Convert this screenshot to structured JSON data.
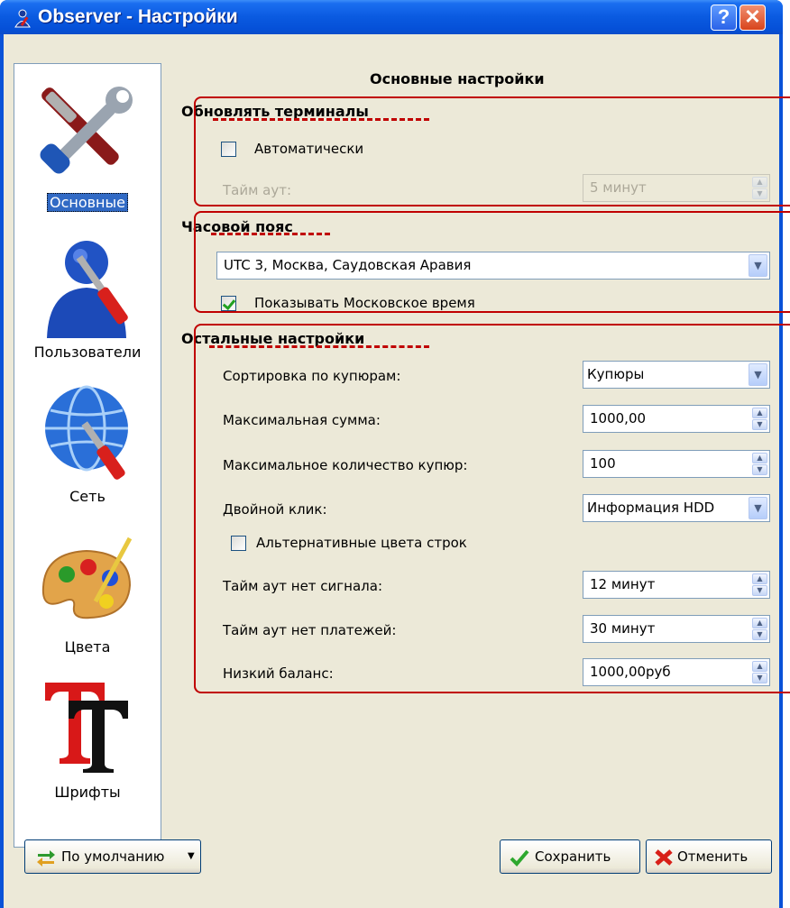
{
  "window": {
    "title": "Observer - Настройки",
    "help_glyph": "?",
    "close_glyph": "✕"
  },
  "sidebar": {
    "items": [
      {
        "label": "Основные",
        "icon": "tools-icon",
        "selected": true
      },
      {
        "label": "Пользователи",
        "icon": "users-icon"
      },
      {
        "label": "Сеть",
        "icon": "network-icon"
      },
      {
        "label": "Цвета",
        "icon": "palette-icon"
      },
      {
        "label": "Шрифты",
        "icon": "fonts-icon"
      }
    ]
  },
  "main": {
    "title": "Основные настройки",
    "update_terminals": {
      "heading": "Обновлять терминалы",
      "auto_label": "Автоматически",
      "auto_checked": false,
      "timeout_label": "Тайм аут:",
      "timeout_value": "5 минут"
    },
    "timezone": {
      "heading": "Часовой пояс",
      "selected": "UTC 3, Москва, Саудовская Аравия",
      "show_moscow_label": "Показывать Московское время",
      "show_moscow_checked": true
    },
    "other": {
      "heading": "Остальные настройки",
      "sort_label": "Сортировка по купюрам:",
      "sort_value": "Купюры",
      "max_sum_label": "Максимальная сумма:",
      "max_sum_value": "1000,00",
      "max_notes_label": "Максимальное количество купюр:",
      "max_notes_value": "100",
      "dblclick_label": "Двойной клик:",
      "dblclick_value": "Информация HDD",
      "alt_colors_label": "Альтернативные цвета строк",
      "alt_colors_checked": false,
      "no_signal_label": "Тайм аут нет сигнала:",
      "no_signal_value": "12 минут",
      "no_payments_label": "Тайм аут нет платежей:",
      "no_payments_value": "30 минут",
      "low_balance_label": "Низкий баланс:",
      "low_balance_value": "1000,00руб"
    }
  },
  "footer": {
    "defaults_label": "По умолчанию",
    "save_label": "Сохранить",
    "cancel_label": "Отменить"
  },
  "colors": {
    "titlebar": "#0a5ae0",
    "annotation": "#c00000",
    "selection": "#316ac5"
  }
}
